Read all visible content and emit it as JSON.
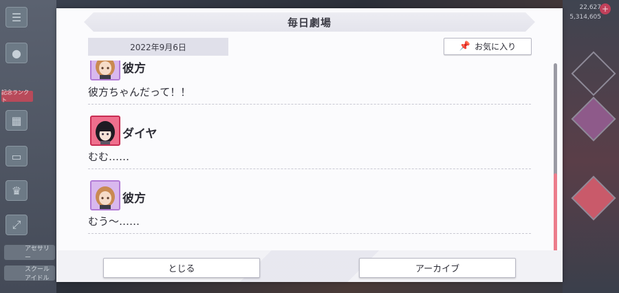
{
  "background": {
    "left_labels": [
      "アセサリー",
      "スクール\nアイドル"
    ],
    "left_tag": "記念ランクト",
    "right_top": [
      "22,627",
      "5,314,605"
    ],
    "right_badge": "ーズ"
  },
  "dialog": {
    "title": "毎日劇場",
    "date": "2022年9月6日",
    "favorite_label": "お気に入り",
    "entries": [
      {
        "speaker": "彼方",
        "line": "彼方ちゃんだって！！",
        "avatar": "purple"
      },
      {
        "speaker": "ダイヤ",
        "line": "むむ……",
        "avatar": "red"
      },
      {
        "speaker": "彼方",
        "line": "むう〜……",
        "avatar": "purple"
      }
    ],
    "close_label": "とじる",
    "archive_label": "アーカイブ"
  },
  "scroll": {
    "position": 0.58,
    "visible_fraction": 0.42
  }
}
